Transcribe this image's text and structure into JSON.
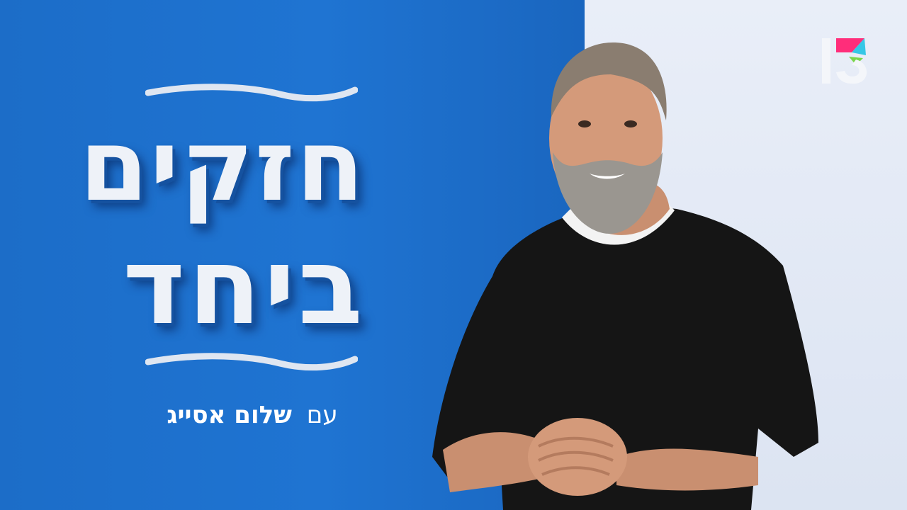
{
  "show": {
    "title_line1": "חזקים",
    "title_line2": "ביחד",
    "subtitle_with": "עם",
    "subtitle_name": "שלום אסייג"
  },
  "channel": {
    "logo": "13-logo"
  },
  "colors": {
    "background_left": "#1f74d2",
    "background_right": "#e4eaf5",
    "title_text": "#eef2f8",
    "sweater": "#141414"
  }
}
